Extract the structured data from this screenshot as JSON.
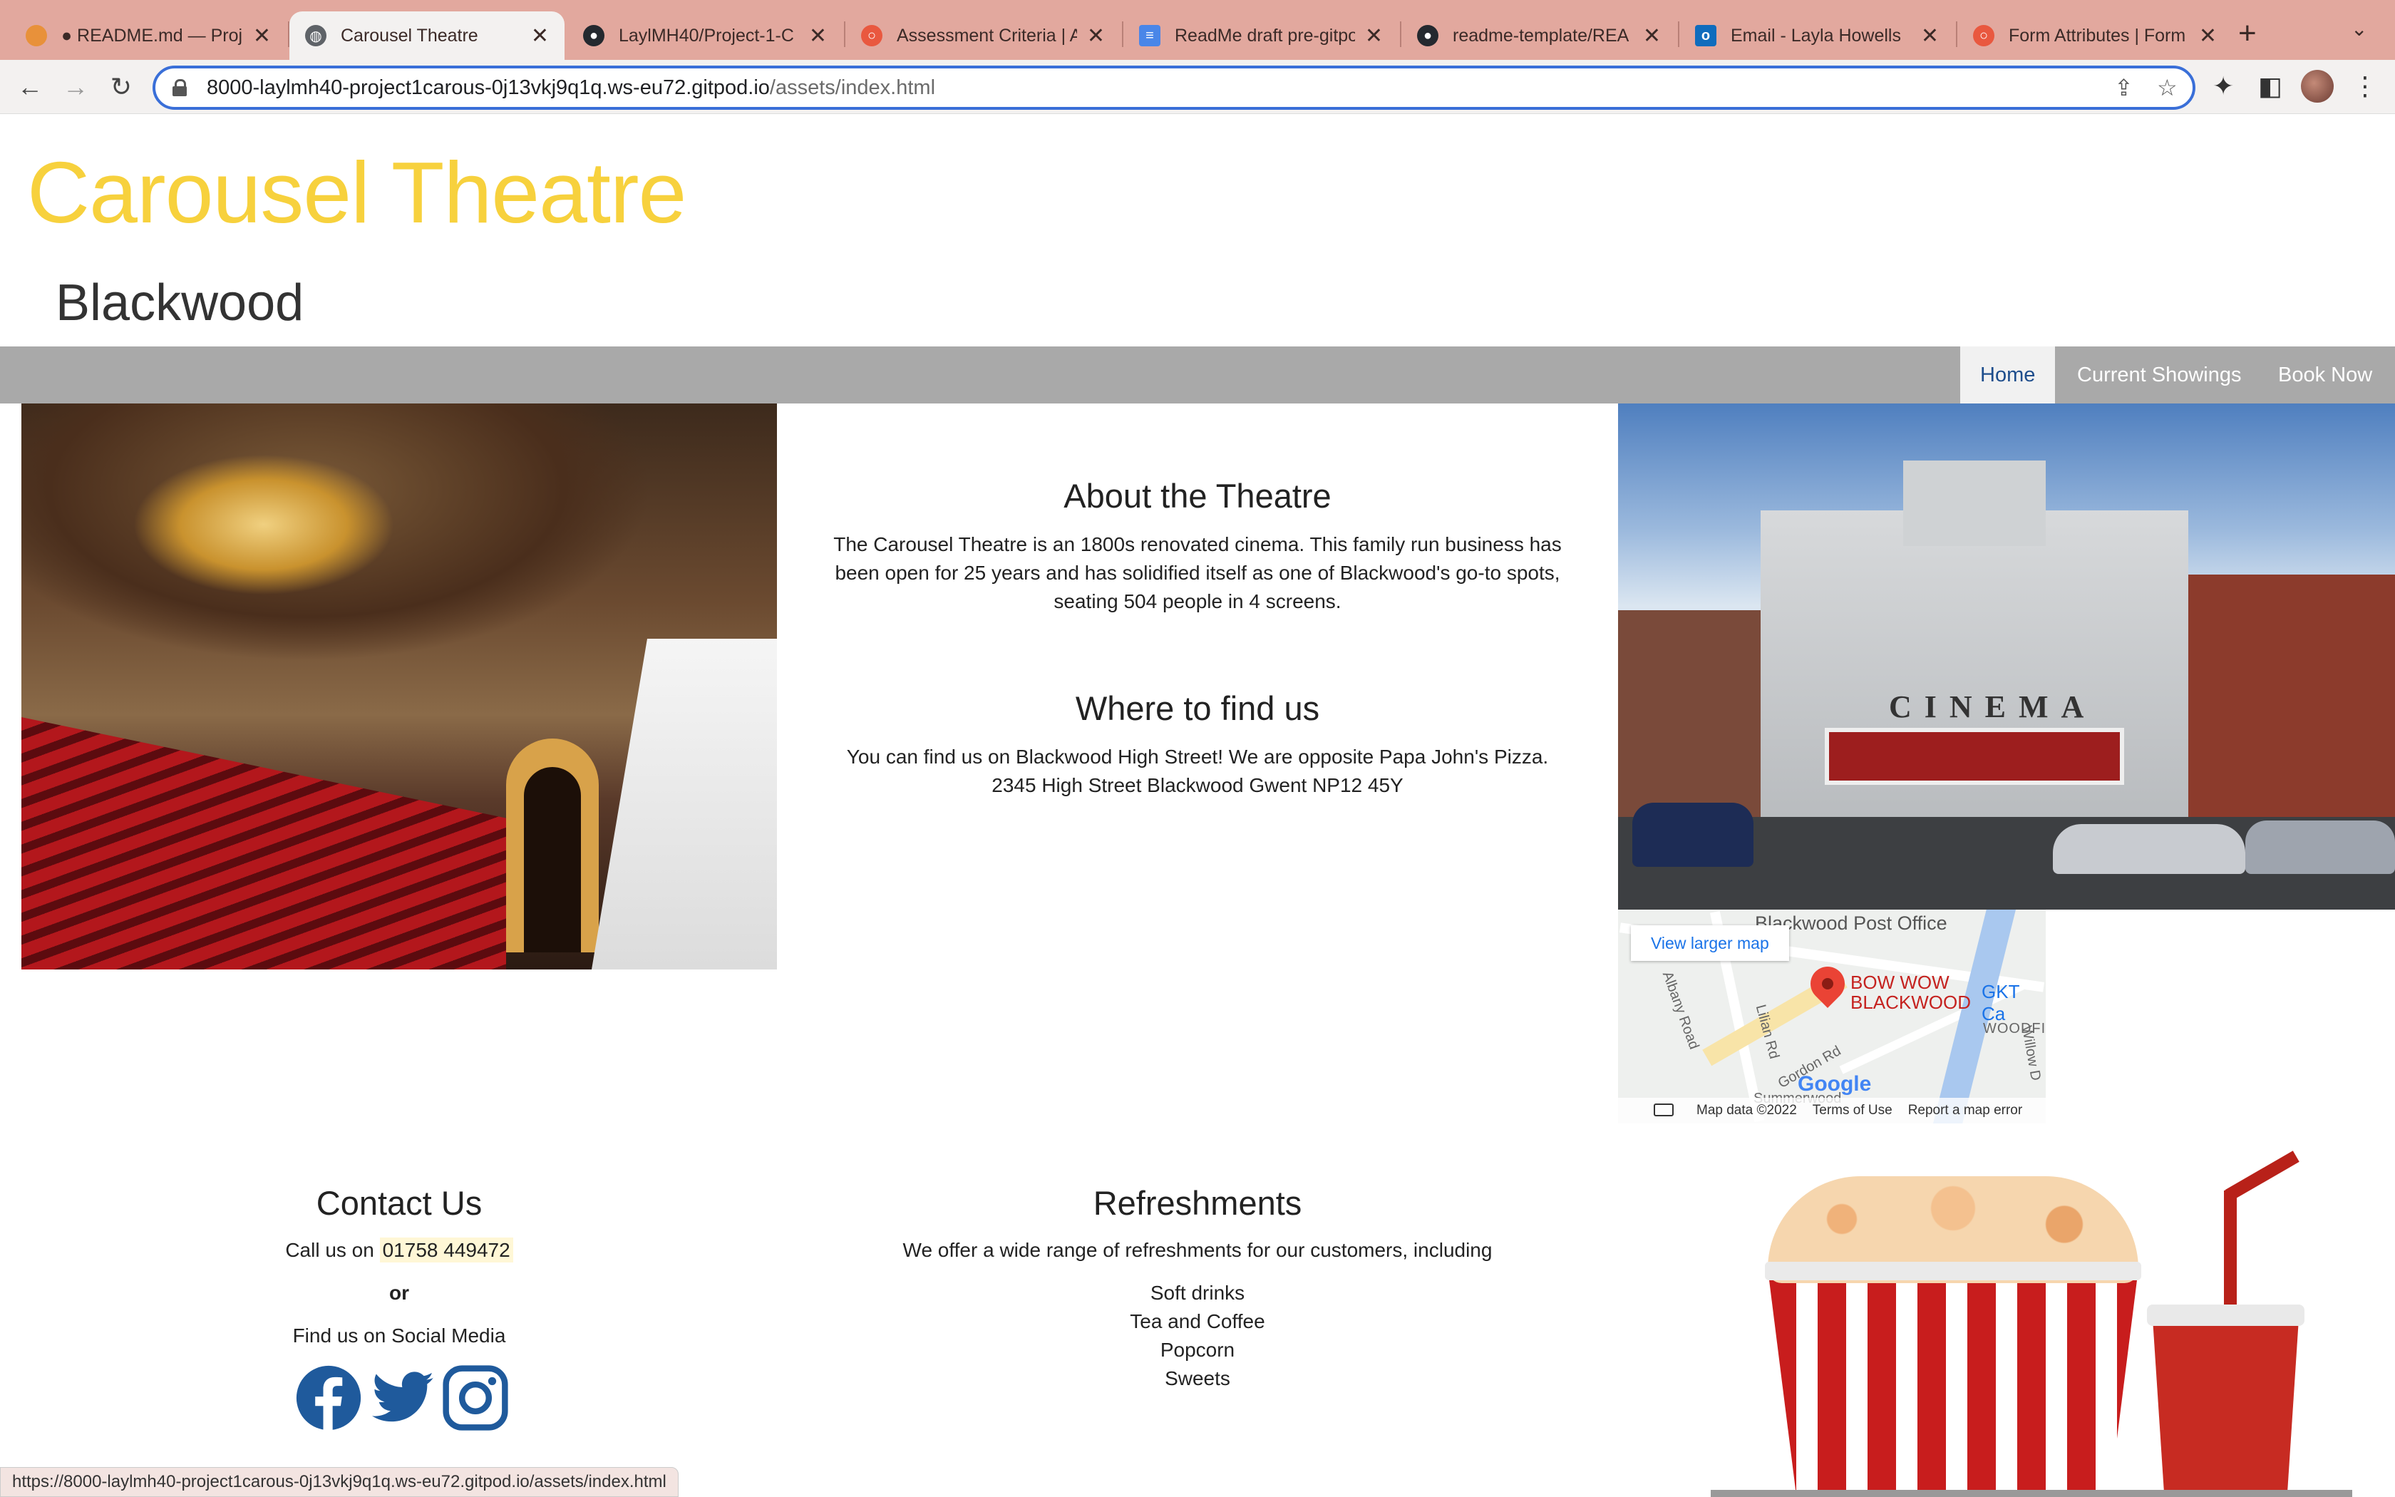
{
  "browser": {
    "tabs": [
      {
        "title": "● README.md — Proje",
        "active": false
      },
      {
        "title": "Carousel Theatre",
        "active": true
      },
      {
        "title": "LaylMH40/Project-1-C",
        "active": false
      },
      {
        "title": "Assessment Criteria | A",
        "active": false
      },
      {
        "title": "ReadMe draft pre-gitpo",
        "active": false
      },
      {
        "title": "readme-template/REA",
        "active": false
      },
      {
        "title": "Email - Layla Howells",
        "active": false
      },
      {
        "title": "Form Attributes | Form",
        "active": false
      }
    ],
    "url_host": "8000-laylmh40-project1carous-0j13vkj9q1q.ws-eu72.gitpod.io",
    "url_path": "/assets/index.html",
    "status_url": "https://8000-laylmh40-project1carous-0j13vkj9q1q.ws-eu72.gitpod.io/assets/index.html",
    "accent": "#3a6fd8",
    "tabstrip_color": "#e2a89e"
  },
  "site": {
    "title": "Carousel Theatre",
    "subtitle": "Blackwood",
    "title_color": "#f7d13d",
    "nav": [
      {
        "label": "Home",
        "active": true
      },
      {
        "label": "Current Showings",
        "active": false
      },
      {
        "label": "Book Now",
        "active": false
      }
    ]
  },
  "about": {
    "heading": "About the Theatre",
    "lines": [
      "The Carousel Theatre is an 1800s renovated cinema. This family run business has",
      "been open for 25 years and has solidified itself as one of Blackwood's go-to spots,",
      "seating 504 people in 4 screens."
    ]
  },
  "find": {
    "heading": "Where to find us",
    "lines": [
      "You can find us on Blackwood High Street! We are opposite Papa John's Pizza.",
      "2345 High Street Blackwood Gwent NP12 45Y"
    ]
  },
  "cinema_photo": {
    "marquee_text": "CINEMA"
  },
  "map": {
    "post_office": "Blackwood Post Office",
    "view_larger": "View larger map",
    "place_line1": "BOW WOW",
    "place_line2": "BLACKWOOD",
    "gkt": "GKT Ca",
    "woodfi": "WOODFI",
    "roads": [
      "Albany Road",
      "Lilian Rd",
      "Gordon Rd",
      "Willow D",
      "Summerwood"
    ],
    "google": "Google",
    "data": "Map data ©2022",
    "terms": "Terms of Use",
    "report": "Report a map error"
  },
  "contact": {
    "heading": "Contact Us",
    "call_prefix": "Call us on",
    "phone": "01758 449472",
    "or": "or",
    "social_text": "Find us on Social Media",
    "icons": [
      "facebook-icon",
      "twitter-icon",
      "instagram-icon"
    ]
  },
  "refreshments": {
    "heading": "Refreshments",
    "intro": "We offer a wide range of refreshments for our customers, including",
    "items": [
      "Soft drinks",
      "Tea and Coffee",
      "Popcorn",
      "Sweets"
    ]
  }
}
